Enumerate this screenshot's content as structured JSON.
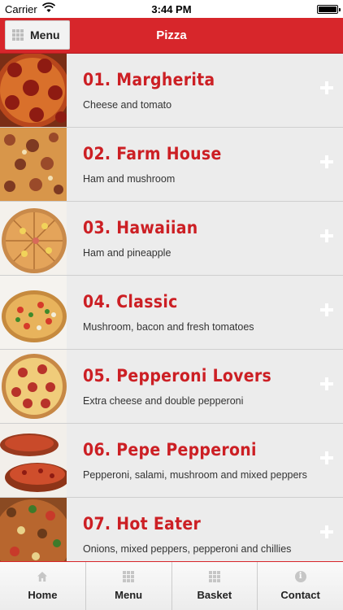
{
  "status_bar": {
    "carrier": "Carrier",
    "time": "3:44 PM"
  },
  "header": {
    "menu_label": "Menu",
    "title": "Pizza"
  },
  "items": [
    {
      "name": "01. Margherita",
      "description": "Cheese and tomato",
      "thumb_icon": "pizza-margherita-photo"
    },
    {
      "name": "02. Farm House",
      "description": "Ham and mushroom",
      "thumb_icon": "pizza-farm-house-photo"
    },
    {
      "name": "03. Hawaiian",
      "description": "Ham and pineapple",
      "thumb_icon": "pizza-hawaiian-photo"
    },
    {
      "name": "04. Classic",
      "description": "Mushroom, bacon and fresh tomatoes",
      "thumb_icon": "pizza-classic-photo"
    },
    {
      "name": "05. Pepperoni Lovers",
      "description": "Extra cheese and double pepperoni",
      "thumb_icon": "pizza-pepperoni-lovers-photo"
    },
    {
      "name": "06. Pepe Pepperoni",
      "description": "Pepperoni, salami, mushroom and mixed peppers",
      "thumb_icon": "pizza-pepe-pepperoni-photo"
    },
    {
      "name": "07. Hot Eater",
      "description": "Onions, mixed peppers, pepperoni and chillies",
      "thumb_icon": "pizza-hot-eater-photo"
    }
  ],
  "tabs": [
    {
      "label": "Home",
      "icon": "home-icon"
    },
    {
      "label": "Menu",
      "icon": "grid-icon"
    },
    {
      "label": "Basket",
      "icon": "grid-icon"
    },
    {
      "label": "Contact",
      "icon": "info-icon"
    }
  ],
  "colors": {
    "brand_red": "#d7262b",
    "title_red": "#cc1f24",
    "list_bg": "#ececec"
  }
}
